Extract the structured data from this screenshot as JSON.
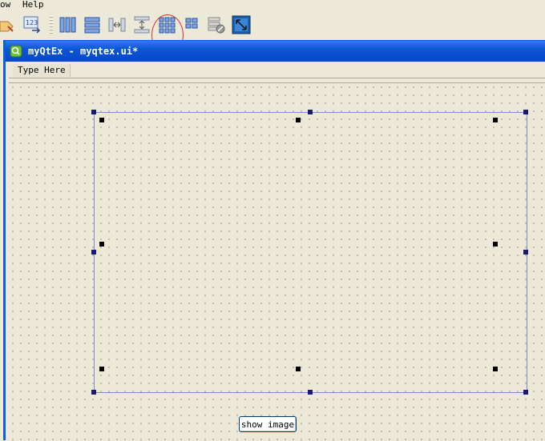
{
  "menu": {
    "item_window_partial": "ow",
    "item_help": "Help"
  },
  "toolbar": {
    "buttons": [
      {
        "icon": "edit-tab-order-icon"
      },
      {
        "icon": "edit-buddies-icon"
      },
      {
        "icon": "layout-horizontal-icon"
      },
      {
        "icon": "layout-vertical-icon"
      },
      {
        "icon": "layout-horizontal-splitter-icon"
      },
      {
        "icon": "layout-vertical-splitter-icon"
      },
      {
        "icon": "layout-grid-icon"
      },
      {
        "icon": "layout-form-icon"
      },
      {
        "icon": "break-layout-icon"
      },
      {
        "icon": "adjust-size-icon"
      }
    ]
  },
  "window": {
    "title": "myQtEx - myqtex.ui*"
  },
  "form": {
    "menubar_placeholder": "Type Here",
    "button_label": "show image"
  }
}
